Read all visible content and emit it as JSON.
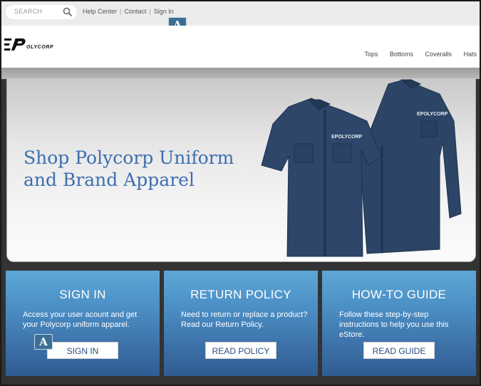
{
  "topbar": {
    "search_placeholder": "SEARCH",
    "links": [
      "Help Center",
      "Contact",
      "Sign In"
    ],
    "separator": "|"
  },
  "badges": {
    "top": "A",
    "panel": "A"
  },
  "header": {
    "logo_text": "POLYCORP",
    "nav": [
      "Tops",
      "Bottoms",
      "Coveralls",
      "Hats"
    ]
  },
  "hero": {
    "title_line1": "Shop Polycorp Uniform",
    "title_line2": "and Brand Apparel",
    "title_color": "#3d6eb0"
  },
  "panels": [
    {
      "title": "SIGN IN",
      "text": "Access your user acount and get your Polycorp uniform apparel.",
      "button": "SIGN IN"
    },
    {
      "title": "RETURN POLICY",
      "text": "Need to return or replace a product? Read our Return Policy.",
      "button": "READ POLICY"
    },
    {
      "title": "HOW-TO GUIDE",
      "text": "Follow these step-by-step instructions to help you use this eStore.",
      "button": "READ GUIDE"
    }
  ],
  "colors": {
    "panel_blue": "#4b8fc5",
    "badge": "#3b6f96",
    "shirt": "#2c4466"
  }
}
